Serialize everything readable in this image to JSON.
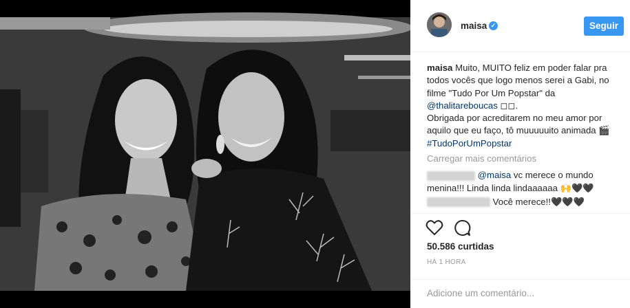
{
  "post": {
    "author": "maisa",
    "follow_label": "Seguir",
    "caption": {
      "author": "maisa",
      "text_1": "Muito, MUITO feliz em poder falar pra todos vocês que logo menos serei a Gabi, no filme \"Tudo Por Um Popstar\" da",
      "mention": "@thalitareboucas",
      "text_2": " ◻◻.",
      "text_3": "Obrigada por acreditarem no meu amor por aquilo que eu faço, tô muuuuuito animada 🎬 ",
      "hashtag": "#TudoPorUmPopstar"
    },
    "load_more": "Carregar mais comentários",
    "comments": [
      {
        "mention": "@maisa",
        "text": " vc merece o mundo menina!!! Linda linda lindaaaaaa 🙌🖤🖤"
      },
      {
        "text": "Você merece!!🖤🖤🖤"
      }
    ],
    "likes": "50.586 curtidas",
    "time": "HÁ 1 HORA",
    "comment_placeholder": "Adicione um comentário..."
  },
  "icons": {
    "verified": "verified-badge-icon",
    "like": "heart-icon",
    "comment": "comment-icon"
  },
  "colors": {
    "accent": "#3897f0",
    "link": "#003569",
    "muted": "#999999",
    "text": "#262626"
  }
}
